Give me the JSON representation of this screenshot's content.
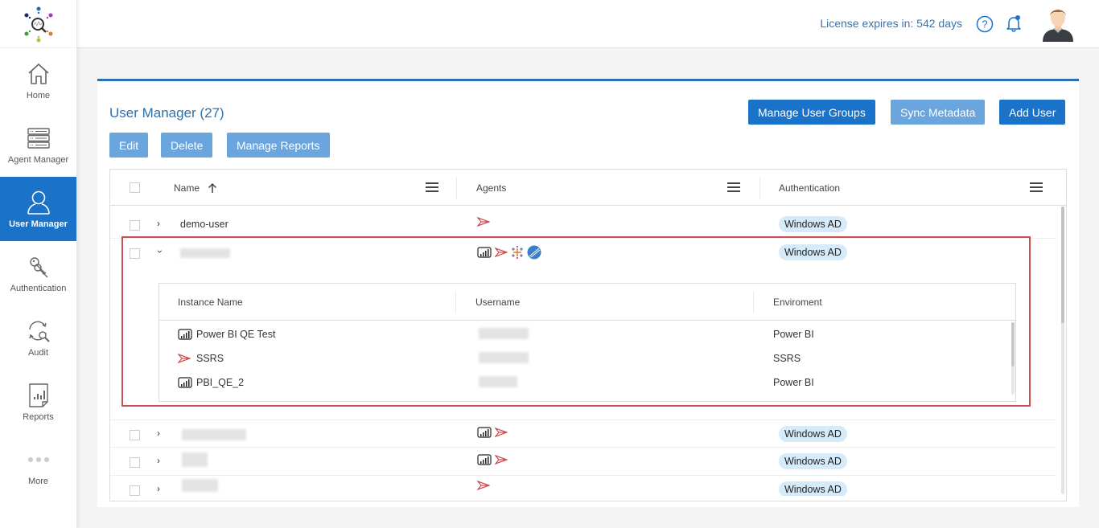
{
  "sidebar": {
    "logo": "logo-icon",
    "items": [
      {
        "label": "Home",
        "icon": "home-icon",
        "active": false
      },
      {
        "label": "Agent Manager",
        "icon": "server-icon",
        "active": false
      },
      {
        "label": "User Manager",
        "icon": "user-icon",
        "active": true
      },
      {
        "label": "Authentication",
        "icon": "keys-icon",
        "active": false
      },
      {
        "label": "Audit",
        "icon": "audit-icon",
        "active": false
      },
      {
        "label": "Reports",
        "icon": "report-icon",
        "active": false
      },
      {
        "label": "More",
        "icon": "more-dots-icon",
        "active": false
      }
    ]
  },
  "topbar": {
    "license_text": "License expires in: 542 days",
    "help_icon": "help-icon",
    "notification_icon": "bell-icon",
    "avatar": "user-avatar"
  },
  "page": {
    "title": "User Manager (27)",
    "buttons": {
      "edit": "Edit",
      "delete": "Delete",
      "manage_reports": "Manage Reports",
      "manage_user_groups": "Manage User Groups",
      "sync_metadata": "Sync Metadata",
      "add_user": "Add User"
    }
  },
  "grid": {
    "columns": [
      "Name",
      "Agents",
      "Authentication"
    ],
    "sort_icon": "sort-ascending-icon",
    "rows": [
      {
        "name": "demo-user",
        "redacted": false,
        "expanded": false,
        "agents": [
          "ssrs"
        ],
        "auth": "Windows AD"
      },
      {
        "name": "",
        "redacted": true,
        "expanded": true,
        "agents": [
          "powerbi",
          "ssrs",
          "tableau",
          "qlik"
        ],
        "auth": "Windows AD"
      },
      {
        "name": "",
        "redacted": true,
        "expanded": false,
        "agents": [
          "powerbi",
          "ssrs"
        ],
        "auth": "Windows AD"
      },
      {
        "name": "",
        "redacted": true,
        "expanded": false,
        "agents": [
          "powerbi",
          "ssrs"
        ],
        "auth": "Windows AD"
      },
      {
        "name": "",
        "redacted": true,
        "expanded": false,
        "agents": [
          "ssrs"
        ],
        "auth": "Windows AD"
      }
    ],
    "detail": {
      "columns": [
        "Instance Name",
        "Username",
        "Enviroment"
      ],
      "rows": [
        {
          "instance": "Power BI QE Test",
          "icon": "powerbi",
          "username_redacted": true,
          "environment": "Power BI"
        },
        {
          "instance": "SSRS",
          "icon": "ssrs",
          "username_redacted": true,
          "environment": "SSRS"
        },
        {
          "instance": "PBI_QE_2",
          "icon": "powerbi",
          "username_redacted": true,
          "environment": "Power BI"
        }
      ]
    }
  },
  "colors": {
    "primary": "#1a73c9",
    "primary_light": "#6aa5de",
    "title": "#2e6fae",
    "badge_bg": "#d6ebfa",
    "highlight_border": "#c9504e"
  }
}
